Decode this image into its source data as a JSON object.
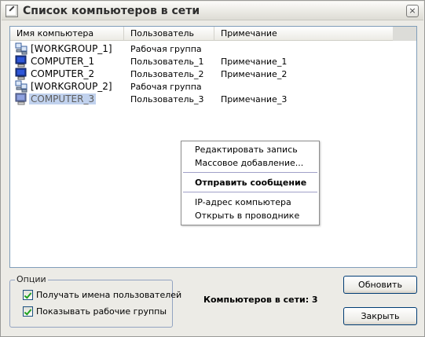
{
  "window": {
    "title": "Список компьютеров в сети",
    "close_glyph": "×"
  },
  "columns": [
    "Имя компьютера",
    "Пользователь",
    "Примечание"
  ],
  "rows": [
    {
      "name": "[WORKGROUP_1]",
      "user": "Рабочая группа",
      "note": "",
      "icon": "workgroup-icon"
    },
    {
      "name": "COMPUTER_1",
      "user": "Пользователь_1",
      "note": "Примечание_1",
      "icon": "computer-icon"
    },
    {
      "name": "COMPUTER_2",
      "user": "Пользователь_2",
      "note": "Примечание_2",
      "icon": "computer-icon"
    },
    {
      "name": "[WORKGROUP_2]",
      "user": "Рабочая группа",
      "note": "",
      "icon": "workgroup-icon"
    },
    {
      "name": "COMPUTER_3",
      "user": "Пользователь_3",
      "note": "Примечание_3",
      "icon": "computer-icon",
      "selected": true
    }
  ],
  "context_menu": {
    "edit": "Редактировать запись",
    "bulk_add": "Массовое добавление...",
    "send_message": "Отправить сообщение",
    "ip": "IP-адрес компьютера",
    "explorer": "Открыть в проводнике"
  },
  "options": {
    "label": "Опции",
    "get_users": "Получать имена пользователей",
    "show_groups": "Показывать рабочие группы"
  },
  "status": {
    "count_text": "Компьютеров в сети: 3"
  },
  "buttons": {
    "refresh": "Обновить",
    "close": "Закрыть"
  },
  "colors": {
    "selection": "#c1d2ee",
    "list_border": "#7f9db9",
    "button_border": "#003c74"
  }
}
